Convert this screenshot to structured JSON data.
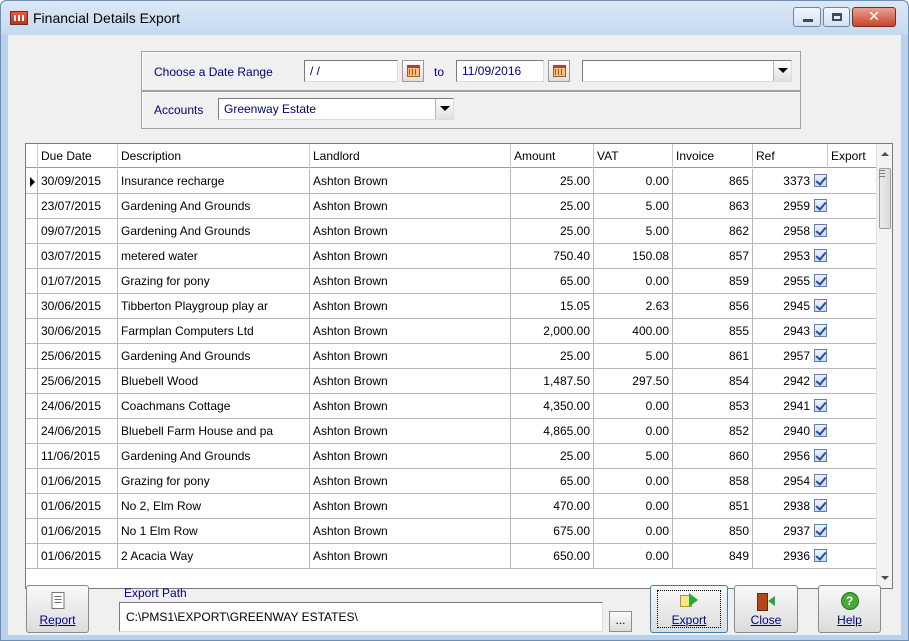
{
  "window": {
    "title": "Financial Details Export"
  },
  "filters": {
    "date_range_label": "Choose a Date Range",
    "from_date": "/ /",
    "to_label": "to",
    "to_date": "11/09/2016",
    "extra_select_value": "",
    "accounts_label": "Accounts",
    "accounts_value": "Greenway Estate"
  },
  "grid": {
    "columns": [
      "Due Date",
      "Description",
      "Landlord",
      "Amount",
      "VAT",
      "Invoice",
      "Ref",
      "Export"
    ],
    "rows": [
      {
        "due_date": "30/09/2015",
        "description": "Insurance recharge",
        "landlord": "Ashton Brown",
        "amount": "25.00",
        "vat": "0.00",
        "invoice": "865",
        "ref": "3373",
        "export": true
      },
      {
        "due_date": "23/07/2015",
        "description": "Gardening And Grounds",
        "landlord": "Ashton Brown",
        "amount": "25.00",
        "vat": "5.00",
        "invoice": "863",
        "ref": "2959",
        "export": true
      },
      {
        "due_date": "09/07/2015",
        "description": "Gardening And Grounds",
        "landlord": "Ashton Brown",
        "amount": "25.00",
        "vat": "5.00",
        "invoice": "862",
        "ref": "2958",
        "export": true
      },
      {
        "due_date": "03/07/2015",
        "description": "metered water",
        "landlord": "Ashton Brown",
        "amount": "750.40",
        "vat": "150.08",
        "invoice": "857",
        "ref": "2953",
        "export": true
      },
      {
        "due_date": "01/07/2015",
        "description": "Grazing for pony",
        "landlord": "Ashton Brown",
        "amount": "65.00",
        "vat": "0.00",
        "invoice": "859",
        "ref": "2955",
        "export": true
      },
      {
        "due_date": "30/06/2015",
        "description": "Tibberton Playgroup play ar",
        "landlord": "Ashton Brown",
        "amount": "15.05",
        "vat": "2.63",
        "invoice": "856",
        "ref": "2945",
        "export": true
      },
      {
        "due_date": "30/06/2015",
        "description": "Farmplan Computers Ltd",
        "landlord": "Ashton Brown",
        "amount": "2,000.00",
        "vat": "400.00",
        "invoice": "855",
        "ref": "2943",
        "export": true
      },
      {
        "due_date": "25/06/2015",
        "description": "Gardening And Grounds",
        "landlord": "Ashton Brown",
        "amount": "25.00",
        "vat": "5.00",
        "invoice": "861",
        "ref": "2957",
        "export": true
      },
      {
        "due_date": "25/06/2015",
        "description": "Bluebell Wood",
        "landlord": "Ashton Brown",
        "amount": "1,487.50",
        "vat": "297.50",
        "invoice": "854",
        "ref": "2942",
        "export": true
      },
      {
        "due_date": "24/06/2015",
        "description": "Coachmans Cottage",
        "landlord": "Ashton Brown",
        "amount": "4,350.00",
        "vat": "0.00",
        "invoice": "853",
        "ref": "2941",
        "export": true
      },
      {
        "due_date": "24/06/2015",
        "description": " Bluebell Farm House and pa",
        "landlord": "Ashton Brown",
        "amount": "4,865.00",
        "vat": "0.00",
        "invoice": "852",
        "ref": "2940",
        "export": true
      },
      {
        "due_date": "11/06/2015",
        "description": "Gardening And Grounds",
        "landlord": "Ashton Brown",
        "amount": "25.00",
        "vat": "5.00",
        "invoice": "860",
        "ref": "2956",
        "export": true
      },
      {
        "due_date": "01/06/2015",
        "description": "Grazing for pony",
        "landlord": "Ashton Brown",
        "amount": "65.00",
        "vat": "0.00",
        "invoice": "858",
        "ref": "2954",
        "export": true
      },
      {
        "due_date": "01/06/2015",
        "description": "No 2, Elm Row",
        "landlord": "Ashton Brown",
        "amount": "470.00",
        "vat": "0.00",
        "invoice": "851",
        "ref": "2938",
        "export": true
      },
      {
        "due_date": "01/06/2015",
        "description": "No 1 Elm Row",
        "landlord": "Ashton Brown",
        "amount": "675.00",
        "vat": "0.00",
        "invoice": "850",
        "ref": "2937",
        "export": true
      },
      {
        "due_date": "01/06/2015",
        "description": "2 Acacia Way",
        "landlord": "Ashton Brown",
        "amount": "650.00",
        "vat": "0.00",
        "invoice": "849",
        "ref": "2936",
        "export": true
      }
    ]
  },
  "footer": {
    "report_label": "Report",
    "export_path_label": "Export Path",
    "export_path_value": "C:\\PMS1\\EXPORT\\GREENWAY ESTATES\\",
    "browse_label": "...",
    "export_label": "Export",
    "close_label": "Close",
    "help_label": "Help"
  },
  "colors": {
    "window_frame": "#b9d1ea",
    "label_blue": "#000080",
    "checkbox_blue": "#2a4c96"
  }
}
